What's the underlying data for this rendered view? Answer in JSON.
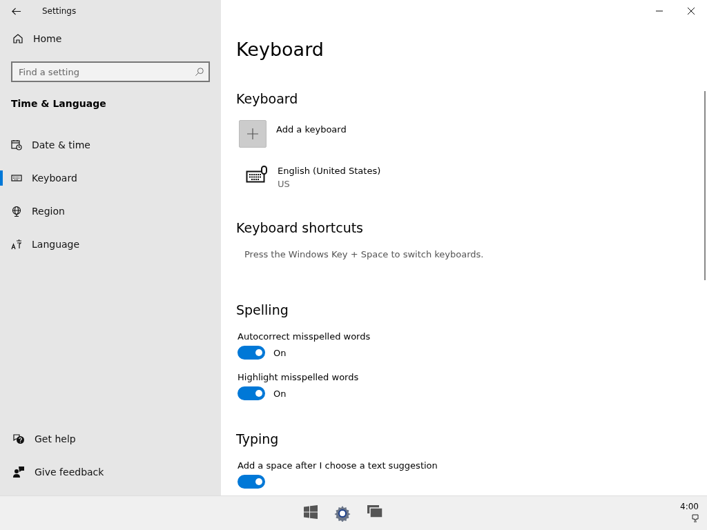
{
  "window": {
    "title": "Settings"
  },
  "sidebar": {
    "home": "Home",
    "search": {
      "placeholder": "Find a setting"
    },
    "category": "Time & Language",
    "items": [
      {
        "label": "Date & time",
        "selected": false
      },
      {
        "label": "Keyboard",
        "selected": true
      },
      {
        "label": "Region",
        "selected": false
      },
      {
        "label": "Language",
        "selected": false
      }
    ],
    "footer": [
      {
        "label": "Get help"
      },
      {
        "label": "Give feedback"
      }
    ]
  },
  "page": {
    "title": "Keyboard",
    "sections": [
      {
        "kind": "keyboards",
        "heading": "Keyboard",
        "add": "Add a keyboard",
        "keyboards": [
          {
            "name": "English (United States)",
            "layout": "US"
          }
        ]
      },
      {
        "kind": "note",
        "heading": "Keyboard shortcuts",
        "text": "Press the Windows Key + Space to switch keyboards."
      },
      {
        "kind": "toggles",
        "heading": "Spelling",
        "toggles": [
          {
            "label": "Autocorrect misspelled words",
            "on": true,
            "state": "On"
          },
          {
            "label": "Highlight misspelled words",
            "on": true,
            "state": "On"
          }
        ]
      },
      {
        "kind": "toggles",
        "heading": "Typing",
        "toggles": [
          {
            "label": "Add a space after I choose a text suggestion",
            "on": true
          }
        ]
      }
    ]
  },
  "taskbar": {
    "clock": "4:00"
  }
}
